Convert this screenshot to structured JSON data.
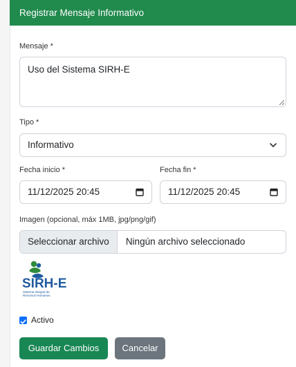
{
  "form": {
    "title": "Registrar Mensaje Informativo",
    "mensaje_label": "Mensaje *",
    "mensaje_value": "Uso del Sistema SIRH-E",
    "tipo_label": "Tipo *",
    "tipo_selected": "Informativo",
    "fecha_inicio_label": "Fecha inicio *",
    "fecha_inicio_value": "11/12/2025 20:45",
    "fecha_fin_label": "Fecha fin *",
    "fecha_fin_value": "11/12/2025 20:45",
    "imagen_label": "Imagen (opcional, máx 1MB, jpg/png/gif)",
    "file_button_label": "Seleccionar archivo",
    "file_status": "Ningún archivo seleccionado",
    "logo_title": "SIRH-E",
    "logo_subtitle_line1": "Sistema Integral de",
    "logo_subtitle_line2": "Recursos Humanos",
    "activo_label": "Activo",
    "activo_checked": true,
    "save_label": "Guardar Cambios",
    "cancel_label": "Cancelar"
  },
  "colors": {
    "header": "#218a4d",
    "save_button": "#198754",
    "cancel_button": "#6c757d",
    "checkbox": "#0d6efd",
    "logo_green": "#2e8b3d",
    "logo_blue": "#1f5aa0"
  },
  "icons": {
    "select": "chevron-down-icon",
    "date": "calendar-icon",
    "checkbox": "check-icon"
  }
}
